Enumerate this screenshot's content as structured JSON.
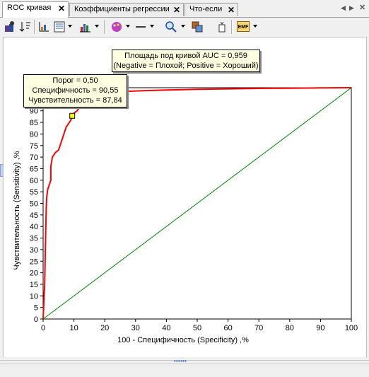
{
  "tabs": [
    {
      "label": "ROC кривая",
      "active": true
    },
    {
      "label": "Коэффициенты регрессии",
      "active": false
    },
    {
      "label": "Что-если",
      "active": false
    }
  ],
  "toolbar": {
    "icons": [
      "export-icon",
      "sort-icon",
      "axis-icon",
      "list-icon",
      "bar-chart-icon",
      "palette-icon",
      "line-style-icon",
      "zoom-icon",
      "copy-image-icon",
      "clear-icon",
      "emf-icon"
    ],
    "emf_label": "EMF"
  },
  "annotations": {
    "auc_line1": "Площадь под кривой AUC = 0,959",
    "auc_line2": "(Negative = Плохой; Positive = Хороший)",
    "threshold": "Порог =  0,50",
    "specificity": "Специфичность = 90,55",
    "sensitivity": "Чувствительность = 87,84"
  },
  "colors": {
    "roc_curve": "#ff0000",
    "diagonal": "#008000",
    "marker": "#ffff00",
    "note_bg": "#ffffe1"
  },
  "chart_data": {
    "type": "line",
    "xlabel": "100 - Специфичность (Specificity) ,%",
    "ylabel": "Чувствительность (Sensitivity) ,%",
    "xlim": [
      0,
      100
    ],
    "ylim": [
      0,
      100
    ],
    "xticks": [
      0,
      10,
      20,
      30,
      40,
      50,
      60,
      70,
      80,
      90,
      100
    ],
    "yticks": [
      0,
      5,
      10,
      15,
      20,
      25,
      30,
      35,
      40,
      45,
      50,
      55,
      60,
      65,
      70,
      75,
      80,
      85,
      90
    ],
    "grid": false,
    "series": [
      {
        "role": "roc",
        "x": [
          0,
          0.5,
          0.8,
          1,
          1.2,
          1.5,
          2,
          2.5,
          2.5,
          3,
          3.5,
          4,
          4.5,
          5,
          6,
          7,
          7.5,
          8,
          8.5,
          9,
          9.45,
          10,
          11,
          12,
          13,
          14,
          15,
          16,
          18,
          20,
          25,
          30,
          40,
          50,
          60,
          70,
          80,
          90,
          100
        ],
        "y": [
          0,
          15,
          35,
          48,
          53,
          56,
          58,
          60,
          66,
          70,
          71,
          72,
          72.5,
          73,
          77,
          81,
          83,
          84,
          85,
          86,
          87.84,
          89,
          90,
          92,
          94,
          95,
          96,
          97,
          97.5,
          98,
          98.3,
          98.6,
          99,
          99.3,
          99.5,
          99.7,
          99.8,
          99.9,
          100
        ]
      },
      {
        "role": "diagonal",
        "x": [
          0,
          100
        ],
        "y": [
          0,
          100
        ]
      }
    ],
    "marker": {
      "x": 9.45,
      "y": 87.84
    }
  }
}
